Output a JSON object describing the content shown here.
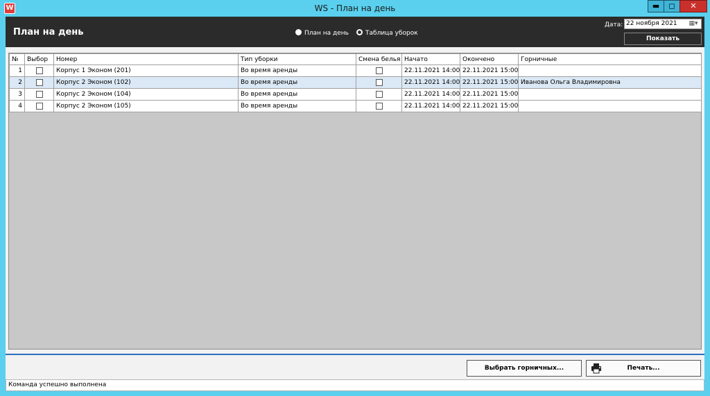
{
  "window": {
    "title": "WS - План на день",
    "app_icon_letter": "W",
    "min_glyph": "▬",
    "max_glyph": "◻",
    "close_glyph": "✕"
  },
  "header": {
    "title": "План на день",
    "radio_plan": "План на день",
    "radio_table": "Таблица уборок",
    "radio_selected": "table",
    "date_label": "Дата:",
    "date_value": "22  ноября  2021",
    "show_button": "Показать"
  },
  "table": {
    "columns": [
      "№",
      "Выбор",
      "Номер",
      "Тип уборки",
      "Смена белья",
      "Начато",
      "Окончено",
      "Горничные"
    ],
    "rows": [
      {
        "num": "1",
        "room": "Корпус 1 Эконом  (201)",
        "type": "Во время аренды",
        "start": "22.11.2021 14:00",
        "end": "22.11.2021 15:00",
        "maids": ""
      },
      {
        "num": "2",
        "room": "Корпус 2 Эконом  (102)",
        "type": "Во время аренды",
        "start": "22.11.2021 14:00",
        "end": "22.11.2021 15:00",
        "maids": "Иванова Ольга Владимировна"
      },
      {
        "num": "3",
        "room": "Корпус 2 Эконом  (104)",
        "type": "Во время аренды",
        "start": "22.11.2021 14:00",
        "end": "22.11.2021 15:00",
        "maids": ""
      },
      {
        "num": "4",
        "room": "Корпус 2 Эконом  (105)",
        "type": "Во время аренды",
        "start": "22.11.2021 14:00",
        "end": "22.11.2021 15:00",
        "maids": ""
      }
    ],
    "selected_row": "2"
  },
  "footer": {
    "select_maids_button": "Выбрать горничных...",
    "print_button": "Печать..."
  },
  "status": {
    "text": "Команда успешно выполнена"
  },
  "icons": {
    "app": "app-icon",
    "calendar": "calendar-icon",
    "printer": "printer-icon"
  }
}
